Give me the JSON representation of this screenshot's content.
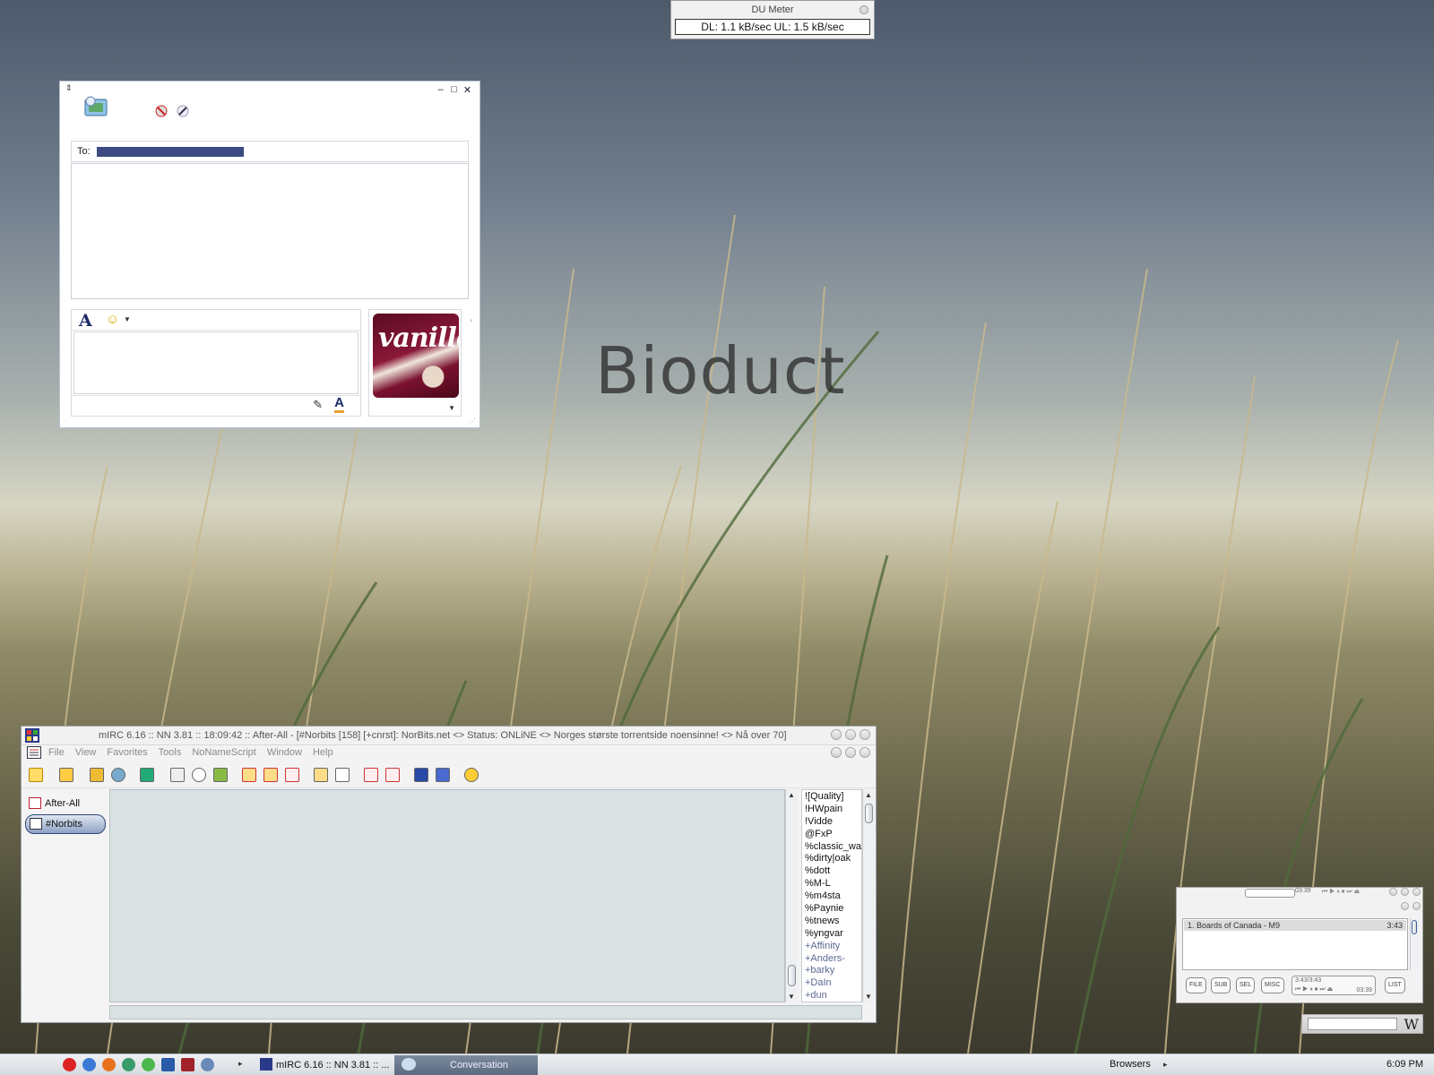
{
  "desktop": {
    "wallpaper_text": "Bioduct"
  },
  "du_meter": {
    "title": "DU Meter",
    "readout": "DL: 1.1 kB/sec  UL: 1.5 kB/sec"
  },
  "messenger": {
    "to_label": "To:",
    "compose_placeholder": "",
    "avatar_text": "vanille"
  },
  "mirc": {
    "title": "mIRC 6.16 :: NN 3.81 :: 18:09:42 :: After-All - [#Norbits [158] [+cnrst]: NorBits.net <> Status: ONLiNE <> Norges største torrentside noensinne! <> Nå over 70]",
    "menu": [
      "File",
      "View",
      "Favorites",
      "Tools",
      "NoNameScript",
      "Window",
      "Help"
    ],
    "switchbar": [
      {
        "label": "After-All",
        "selected": false
      },
      {
        "label": "#Norbits",
        "selected": true
      }
    ],
    "nicks": [
      "![Quality]",
      "!HWpain",
      "!Vidde",
      "@FxP",
      "%classic_war",
      "%dirty|oak",
      "%dott",
      "%M-L",
      "%m4sta",
      "%Paynie",
      "%tnews",
      "%yngvar",
      "+Affinity",
      "+Anders-",
      "+barky",
      "+DaIn",
      "+dun"
    ]
  },
  "player": {
    "track": "1. Boards of Canada - M9",
    "duration": "3:43",
    "time_small": "03:39",
    "time_main": "3:43/3:43",
    "time_right": "03:39",
    "buttons": [
      "FILE",
      "SUB",
      "SEL",
      "MISC",
      "LIST"
    ]
  },
  "wikipedia": {
    "logo": "W"
  },
  "taskbar": {
    "buttons": [
      "mIRC 6.16 :: NN 3.81 :: ...",
      "Conversation"
    ],
    "browsers_label": "Browsers",
    "clock": "6:09 PM"
  }
}
